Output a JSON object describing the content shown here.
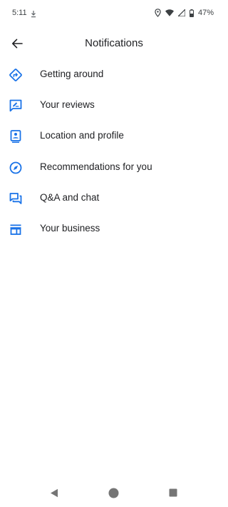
{
  "status_bar": {
    "time": "5:11",
    "battery_percent": "47%",
    "icons": [
      "download-icon",
      "location-icon",
      "wifi-icon",
      "signal-icon",
      "battery-icon"
    ]
  },
  "header": {
    "title": "Notifications",
    "back_icon": "arrow-back-icon"
  },
  "menu": {
    "items": [
      {
        "label": "Getting around",
        "icon": "directions-icon"
      },
      {
        "label": "Your reviews",
        "icon": "rate-review-icon"
      },
      {
        "label": "Location and profile",
        "icon": "contact-profile-icon"
      },
      {
        "label": "Recommendations for you",
        "icon": "explore-icon"
      },
      {
        "label": "Q&A and chat",
        "icon": "forum-icon"
      },
      {
        "label": "Your business",
        "icon": "storefront-icon"
      }
    ]
  },
  "nav_bar": {
    "icons": [
      "back-triangle-icon",
      "home-circle-icon",
      "recents-square-icon"
    ]
  },
  "colors": {
    "accent": "#1a73e8",
    "text": "#202124",
    "secondary_text": "#3c4043",
    "nav_icon": "#757575"
  }
}
